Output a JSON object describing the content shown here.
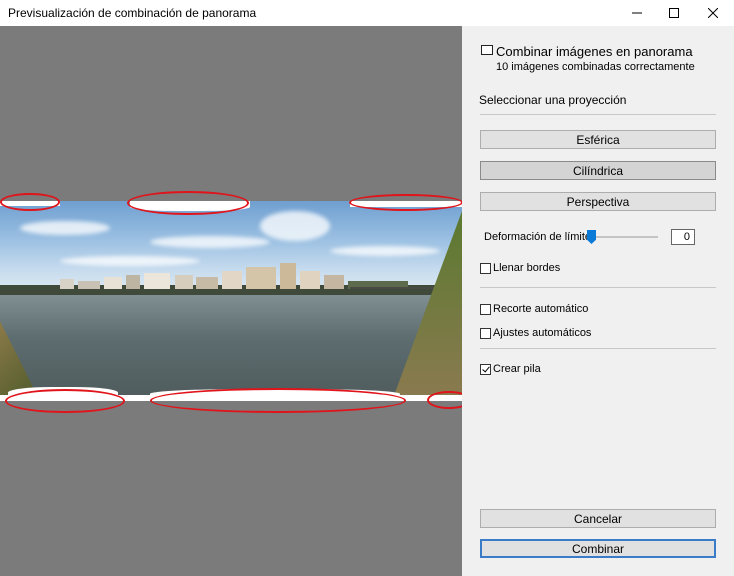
{
  "window": {
    "title": "Previsualización de combinación de panorama",
    "minimize_icon": "minimize-icon",
    "maximize_icon": "maximize-icon",
    "close_icon": "close-icon"
  },
  "panel": {
    "heading": "Combinar imágenes en panorama",
    "status": "10 imágenes combinadas correctamente",
    "projection_label": "Seleccionar una proyección",
    "projections": [
      "Esférica",
      "Cilíndrica",
      "Perspectiva"
    ],
    "selected_projection": "Cilíndrica",
    "boundary_warp_label": "Deformación de límite:",
    "boundary_warp_value": "0",
    "fill_edges_label": "Llenar bordes",
    "fill_edges_checked": false,
    "auto_crop_label": "Recorte automático",
    "auto_crop_checked": false,
    "auto_settings_label": "Ajustes automáticos",
    "auto_settings_checked": false,
    "create_stack_label": "Crear pila",
    "create_stack_checked": true,
    "cancel_label": "Cancelar",
    "merge_label": "Combinar"
  },
  "colors": {
    "annotation_red": "#e0141a",
    "slider_accent": "#0a7ad6",
    "default_button_border": "#3b7cc9",
    "preview_background": "#7b7b7b",
    "panel_background": "#f0f0f0"
  }
}
